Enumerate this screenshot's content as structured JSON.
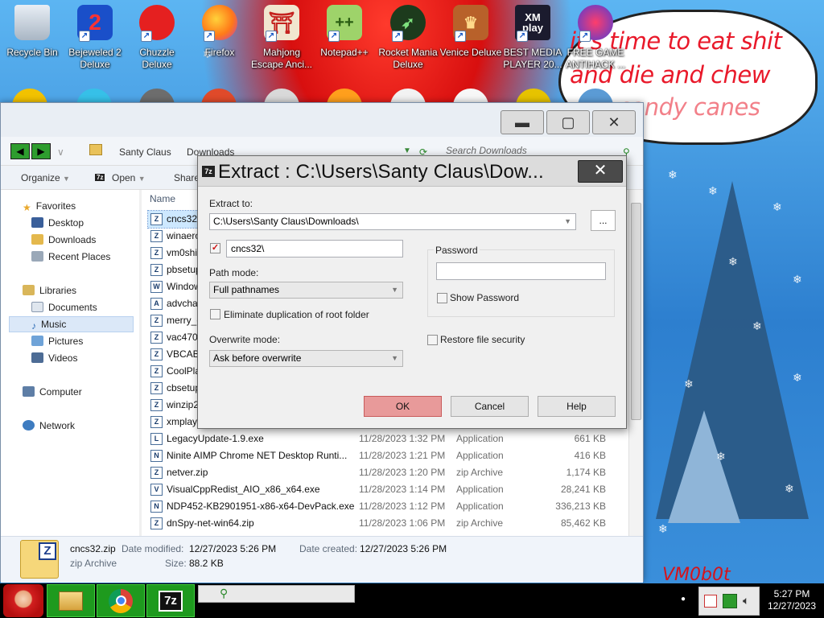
{
  "desktop": {
    "icons": [
      {
        "label1": "Recycle Bin",
        "label2": ""
      },
      {
        "label1": "Bejeweled 2",
        "label2": "Deluxe"
      },
      {
        "label1": "Chuzzle",
        "label2": "Deluxe"
      },
      {
        "label1": "Firefox",
        "label2": ""
      },
      {
        "label1": "Mahjong",
        "label2": "Escape Anci..."
      },
      {
        "label1": "Notepad++",
        "label2": ""
      },
      {
        "label1": "Rocket Mania",
        "label2": "Deluxe"
      },
      {
        "label1": "Venice Deluxe",
        "label2": ""
      },
      {
        "label1": "BEST MEDIA",
        "label2": "PLAYER 20..."
      },
      {
        "label1": "FREE GAME",
        "label2": "ANTIHACK ..."
      }
    ],
    "speech_line1": "it's time to eat shit",
    "speech_line2": "and die and chew",
    "speech_line3": "candy canes",
    "sign_text": "VM0b0t"
  },
  "explorer": {
    "breadcrumb": [
      "Santy Claus",
      "Downloads"
    ],
    "search_placeholder": "Search Downloads",
    "toolbar": {
      "organize": "Organize",
      "open": "Open",
      "share": "Share"
    },
    "nav": {
      "favorites": "Favorites",
      "desktop": "Desktop",
      "downloads": "Downloads",
      "recent": "Recent Places",
      "libraries": "Libraries",
      "documents": "Documents",
      "music": "Music",
      "pictures": "Pictures",
      "videos": "Videos",
      "computer": "Computer",
      "network": "Network"
    },
    "column_name": "Name",
    "files": [
      {
        "name": "cncs32.",
        "date": "",
        "type": "",
        "size": "",
        "icon": "Z"
      },
      {
        "name": "winaero",
        "date": "",
        "type": "",
        "size": "",
        "icon": "Z"
      },
      {
        "name": "vm0shi",
        "date": "",
        "type": "",
        "size": "",
        "icon": "Z"
      },
      {
        "name": "pbsetup",
        "date": "",
        "type": "",
        "size": "",
        "icon": "Z"
      },
      {
        "name": "Window",
        "date": "",
        "type": "",
        "size": "",
        "icon": "W"
      },
      {
        "name": "advcha",
        "date": "",
        "type": "",
        "size": "",
        "icon": "A"
      },
      {
        "name": "merry_c",
        "date": "",
        "type": "",
        "size": "",
        "icon": "Z"
      },
      {
        "name": "vac470.",
        "date": "",
        "type": "",
        "size": "",
        "icon": "Z"
      },
      {
        "name": "VBCABI",
        "date": "",
        "type": "",
        "size": "",
        "icon": "Z"
      },
      {
        "name": "CoolPla",
        "date": "",
        "type": "",
        "size": "",
        "icon": "Z"
      },
      {
        "name": "cbsetup",
        "date": "",
        "type": "",
        "size": "",
        "icon": "Z"
      },
      {
        "name": "winzip2",
        "date": "",
        "type": "",
        "size": "",
        "icon": "Z"
      },
      {
        "name": "xmplay",
        "date": "",
        "type": "",
        "size": "",
        "icon": "Z"
      },
      {
        "name": "LegacyUpdate-1.9.exe",
        "date": "11/28/2023 1:32 PM",
        "type": "Application",
        "size": "661 KB",
        "icon": "L"
      },
      {
        "name": "Ninite AIMP Chrome NET Desktop Runti...",
        "date": "11/28/2023 1:21 PM",
        "type": "Application",
        "size": "416 KB",
        "icon": "N"
      },
      {
        "name": "netver.zip",
        "date": "11/28/2023 1:20 PM",
        "type": "zip Archive",
        "size": "1,174 KB",
        "icon": "Z"
      },
      {
        "name": "VisualCppRedist_AIO_x86_x64.exe",
        "date": "11/28/2023 1:14 PM",
        "type": "Application",
        "size": "28,241 KB",
        "icon": "V"
      },
      {
        "name": "NDP452-KB2901951-x86-x64-DevPack.exe",
        "date": "11/28/2023 1:12 PM",
        "type": "Application",
        "size": "336,213 KB",
        "icon": "N"
      },
      {
        "name": "dnSpy-net-win64.zip",
        "date": "11/28/2023 1:06 PM",
        "type": "zip Archive",
        "size": "85,462 KB",
        "icon": "Z"
      }
    ],
    "details": {
      "filename": "cncs32.zip",
      "filetype": "zip Archive",
      "modified_label": "Date modified:",
      "modified_value": "12/27/2023 5:26 PM",
      "created_label": "Date created:",
      "created_value": "12/27/2023 5:26 PM",
      "size_label": "Size:",
      "size_value": "88.2 KB"
    }
  },
  "dialog": {
    "title": "Extract : C:\\Users\\Santy Claus\\Dow...",
    "extract_to_label": "Extract to:",
    "extract_to_value": "C:\\Users\\Santy Claus\\Downloads\\",
    "browse_label": "...",
    "subfolder_value": "cncs32\\",
    "path_mode_label": "Path mode:",
    "path_mode_value": "Full pathnames",
    "eliminate_label": "Eliminate duplication of root folder",
    "overwrite_label": "Overwrite mode:",
    "overwrite_value": "Ask before overwrite",
    "password_label": "Password",
    "show_password_label": "Show Password",
    "restore_security_label": "Restore file security",
    "ok_label": "OK",
    "cancel_label": "Cancel",
    "help_label": "Help"
  },
  "taskbar": {
    "time": "5:27 PM",
    "date": "12/27/2023"
  }
}
